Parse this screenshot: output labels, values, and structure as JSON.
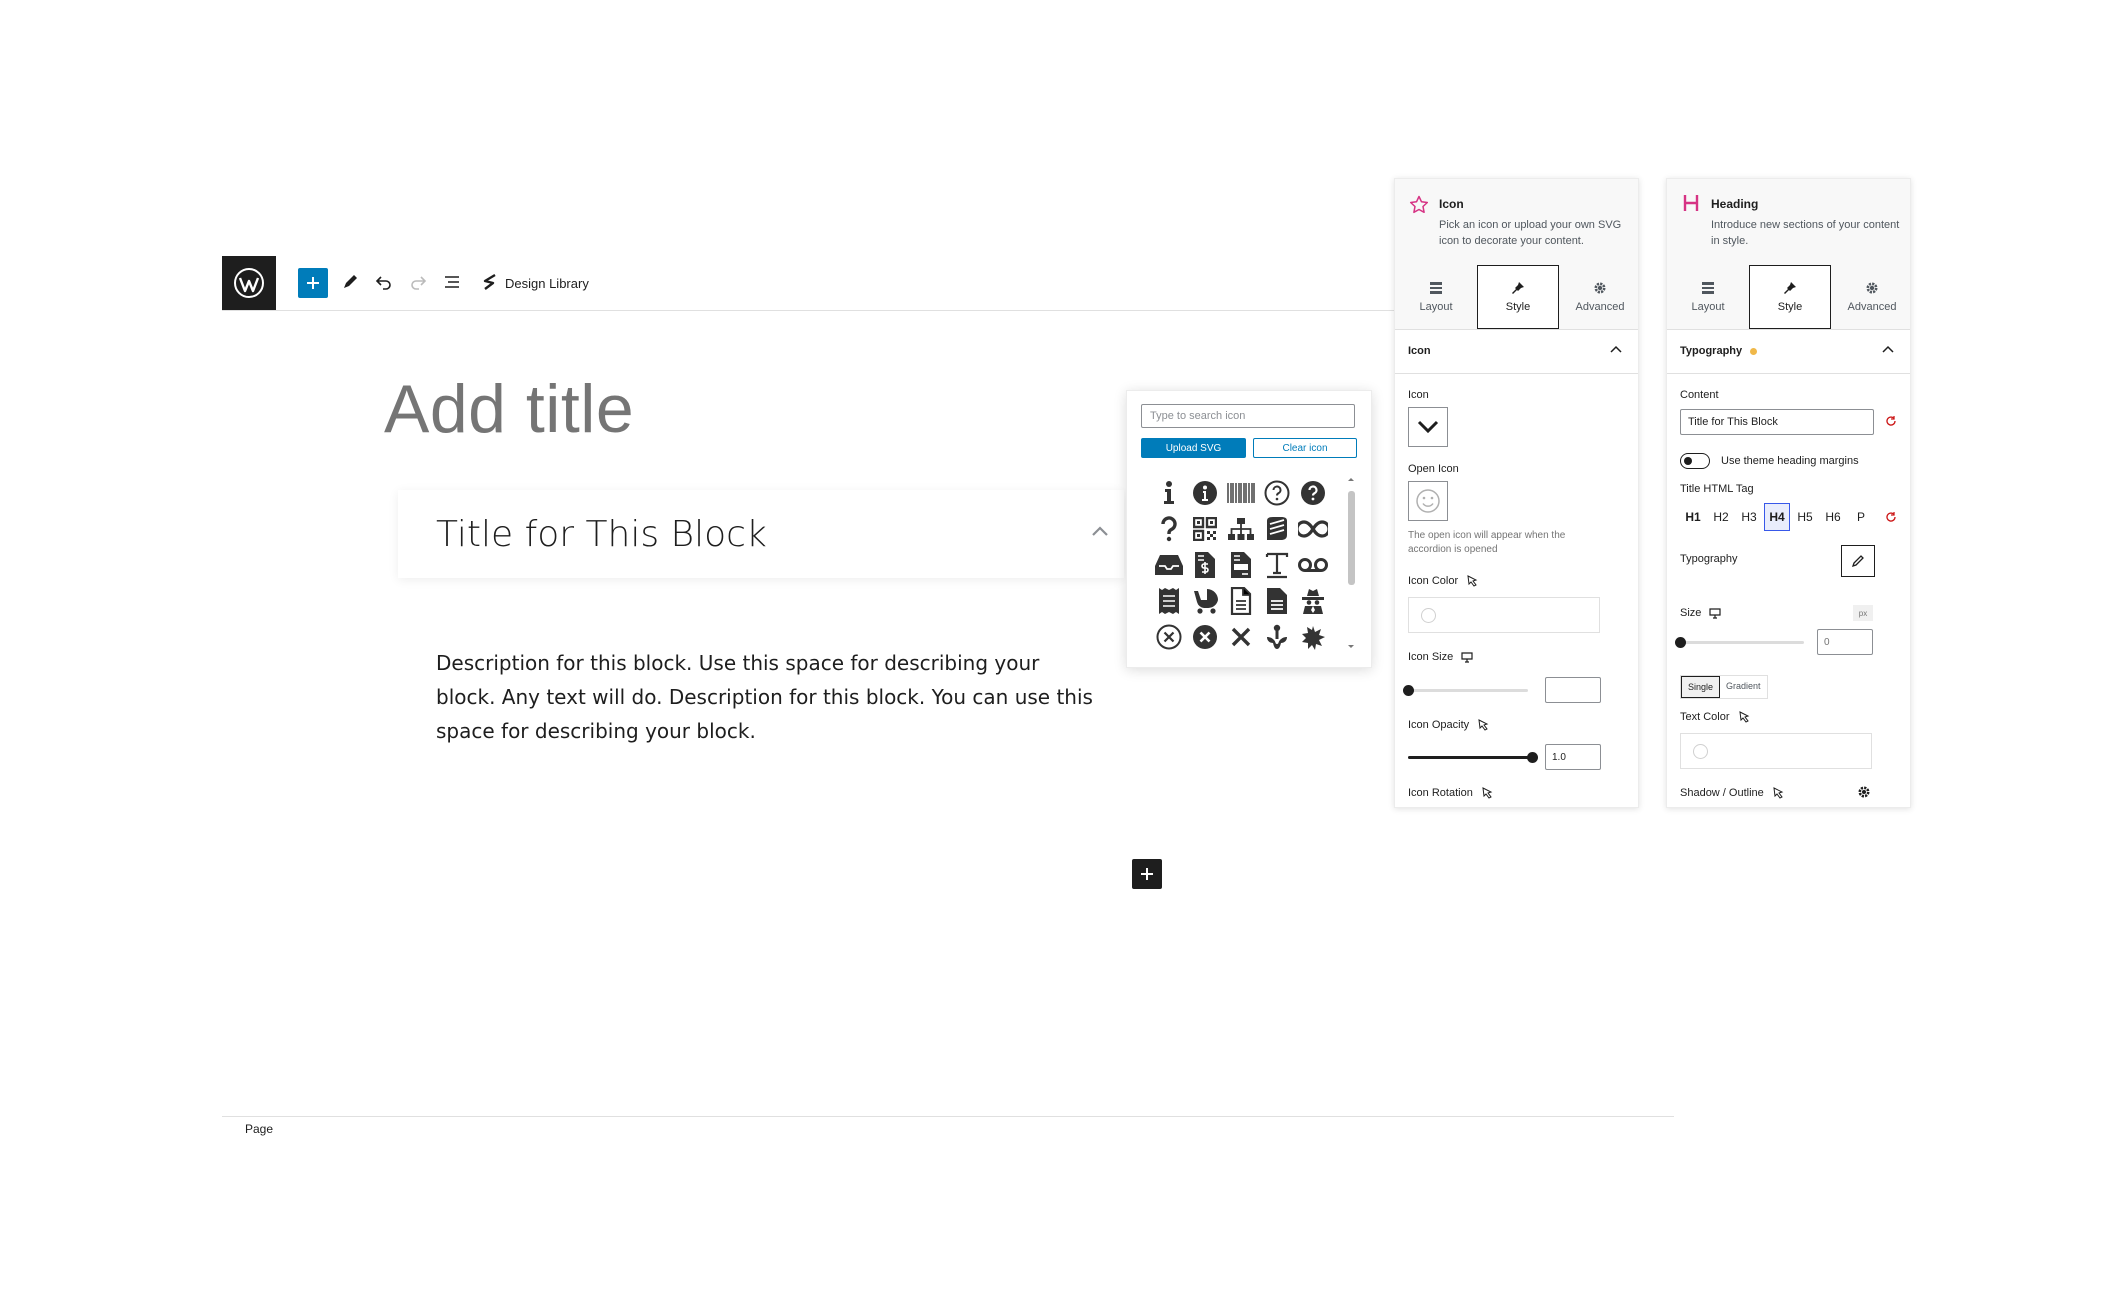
{
  "toolbar": {
    "design_library_label": "Design Library"
  },
  "editor": {
    "title_placeholder": "Add title",
    "block_title": "Title for This Block",
    "description": "Description for this block. Use this space for describing your block. Any text will do. Description for this block. You can use this space for describing your block.",
    "breadcrumb": "Page"
  },
  "icon_picker": {
    "search_placeholder": "Type to search icon",
    "upload_label": "Upload SVG",
    "clear_label": "Clear icon",
    "icons": [
      "info",
      "info-circle",
      "barcode",
      "question-circle-outline",
      "question-circle",
      "question",
      "qrcode",
      "sitemap",
      "stackexchange",
      "infinity",
      "inbox",
      "file-invoice-dollar",
      "file-invoice",
      "text-height",
      "voicemail",
      "receipt",
      "baby-carriage",
      "file-alt",
      "file",
      "user-secret",
      "times-circle-outline",
      "times-circle",
      "times",
      "mendeley",
      "fill-splatter"
    ]
  },
  "icon_panel": {
    "name": "Icon",
    "description": "Pick an icon or upload your own SVG icon to decorate your content.",
    "accent_color": "#d63384",
    "tabs": [
      {
        "label": "Layout"
      },
      {
        "label": "Style"
      },
      {
        "label": "Advanced"
      }
    ],
    "active_tab": "Style",
    "section": "Icon",
    "icon_label": "Icon",
    "open_icon_label": "Open Icon",
    "open_icon_note": "The open icon will appear when the accordion is opened",
    "icon_color_label": "Icon Color",
    "icon_size_label": "Icon Size",
    "icon_size_value": "",
    "icon_opacity_label": "Icon Opacity",
    "icon_opacity_value": "1.0",
    "icon_rotation_label": "Icon Rotation"
  },
  "heading_panel": {
    "name": "Heading",
    "description": "Introduce new sections of your content in style.",
    "tabs": [
      {
        "label": "Layout"
      },
      {
        "label": "Style"
      },
      {
        "label": "Advanced"
      }
    ],
    "active_tab": "Style",
    "section": "Typography",
    "content_label": "Content",
    "content_value": "Title for This Block",
    "theme_margins_label": "Use theme heading margins",
    "html_tag_label": "Title HTML Tag",
    "tags": [
      "H1",
      "H2",
      "H3",
      "H4",
      "H5",
      "H6",
      "P"
    ],
    "active_tag": "H4",
    "typography_label": "Typography",
    "size_label": "Size",
    "size_unit": "px",
    "size_value": "0",
    "color_type_options": [
      "Single",
      "Gradient"
    ],
    "active_color_type": "Single",
    "text_color_label": "Text Color",
    "shadow_label": "Shadow / Outline"
  },
  "colors": {
    "primary": "#007cba",
    "dark": "#1e1e1e",
    "heading_accent": "#d63384",
    "modified_dot": "#f0b849",
    "reset": "#cc1818"
  }
}
